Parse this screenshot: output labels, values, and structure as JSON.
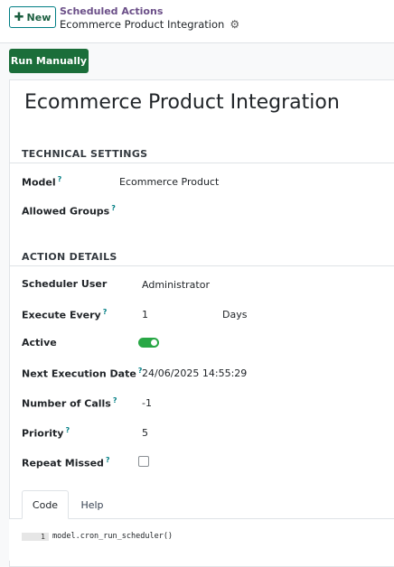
{
  "toolbar": {
    "new_label": "New",
    "run_label": "Run Manually"
  },
  "breadcrumb": {
    "parent": "Scheduled Actions",
    "current": "Ecommerce Product Integration"
  },
  "record": {
    "title": "Ecommerce Product Integration"
  },
  "technical": {
    "section_title": "TECHNICAL SETTINGS",
    "model_label": "Model",
    "model_value": "Ecommerce Product",
    "groups_label": "Allowed Groups"
  },
  "action": {
    "section_title": "ACTION DETAILS",
    "user_label": "Scheduler User",
    "user_value": "Administrator",
    "every_label": "Execute Every",
    "every_value": "1",
    "every_unit": "Days",
    "active_label": "Active",
    "active_value": true,
    "next_label": "Next Execution Date",
    "next_value": "24/06/2025 14:55:29",
    "calls_label": "Number of Calls",
    "calls_value": "-1",
    "priority_label": "Priority",
    "priority_value": "5",
    "repeat_label": "Repeat Missed",
    "repeat_value": false
  },
  "tabs": [
    {
      "label": "Code",
      "active": true
    },
    {
      "label": "Help",
      "active": false
    }
  ],
  "code": {
    "line_number": "1",
    "text": "model.cron_run_scheduler()"
  },
  "help_marker": "?",
  "icons": {
    "new": "plus-icon",
    "settings": "gear-icon"
  },
  "colors": {
    "primary_button": "#1b6e3a",
    "toggle_on": "#28a745",
    "breadcrumb_parent": "#6b4f88"
  }
}
